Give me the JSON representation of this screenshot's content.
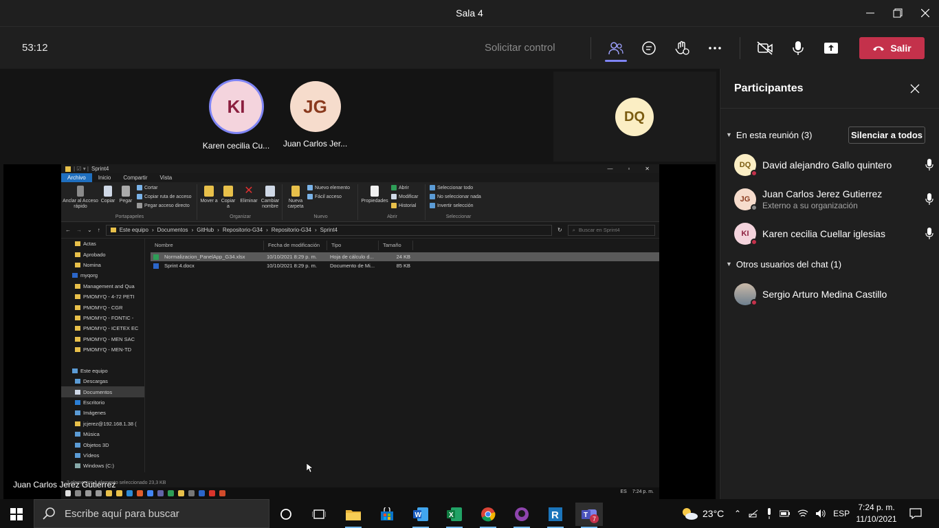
{
  "window": {
    "title": "Sala 4"
  },
  "meeting": {
    "timer": "53:12",
    "request_control": "Solicitar control",
    "leave_label": "Salir",
    "colors": {
      "accent": "#7f85f5",
      "leave": "#c4314b"
    }
  },
  "stage": {
    "tiles": [
      {
        "initials": "KI",
        "name": "Karen cecilia Cu..."
      },
      {
        "initials": "JG",
        "name": "Juan Carlos Jer..."
      }
    ],
    "side_tile": {
      "initials": "DQ"
    },
    "share_presenter": "Juan Carlos Jerez Gutierrez"
  },
  "explorer": {
    "title": "Sprint4",
    "menu": [
      "Archivo",
      "Inicio",
      "Compartir",
      "Vista"
    ],
    "ribbon": {
      "clipboard": {
        "pin": "Anclar al Acceso rápido",
        "copy": "Copiar",
        "paste": "Pegar",
        "cut": "Cortar",
        "copy_path": "Copiar ruta de acceso",
        "paste_shortcut": "Pegar acceso directo",
        "group": "Portapapeles"
      },
      "organize": {
        "move": "Mover a",
        "copy_to": "Copiar a",
        "delete": "Eliminar",
        "rename": "Cambiar nombre",
        "group": "Organizar"
      },
      "new": {
        "folder": "Nueva carpeta",
        "new_item": "Nuevo elemento",
        "easy_access": "Fácil acceso",
        "group": "Nuevo"
      },
      "open": {
        "properties": "Propiedades",
        "open": "Abrir",
        "edit": "Modificar",
        "history": "Historial",
        "group": "Abrir"
      },
      "select": {
        "all": "Seleccionar todo",
        "none": "No seleccionar nada",
        "invert": "Invertir selección",
        "group": "Seleccionar"
      }
    },
    "breadcrumb": [
      "Este equipo",
      "Documentos",
      "GitHub",
      "Repositorio-G34",
      "Repositorio-G34",
      "Sprint4"
    ],
    "search_placeholder": "Buscar en Sprint4",
    "tree": [
      "Actas",
      "Aprobado",
      "Nomina",
      "myqorg",
      "Management and Qua",
      "PMOMYQ - 4-72 PETI",
      "PMOMYQ - CGR",
      "PMOMYQ - FONTIC -",
      "PMOMYQ - ICETEX EC",
      "PMOMYQ - MEN SAC",
      "PMOMYQ - MEN-TD",
      "",
      "Este equipo",
      "Descargas",
      "Documentos",
      "Escritorio",
      "Imágenes",
      "jcjerez@192.168.1.38 (",
      "Música",
      "Objetos 3D",
      "Vídeos",
      "Windows (C:)"
    ],
    "columns": [
      "Nombre",
      "Fecha de modificación",
      "Tipo",
      "Tamaño"
    ],
    "files": [
      {
        "name": "Normalizacion_PanelApp_G34.xlsx",
        "date": "10/10/2021 8:29 p. m.",
        "type": "Hoja de cálculo d...",
        "size": "24 KB"
      },
      {
        "name": "Sprint 4.docx",
        "date": "10/10/2021 8:29 p. m.",
        "type": "Documento de Mi...",
        "size": "85 KB"
      }
    ],
    "status": "2 elementos   1 elemento seleccionado  23,3 KB",
    "taskbar": {
      "lang": "ES",
      "time": "7:24 p. m."
    }
  },
  "panel": {
    "title": "Participantes",
    "in_meeting": "En esta reunión (3)",
    "mute_all": "Silenciar a todos",
    "participants": [
      {
        "initials": "DQ",
        "name": "David alejandro Gallo quintero",
        "sub": ""
      },
      {
        "initials": "JG",
        "name": "Juan Carlos Jerez Gutierrez",
        "sub": "Externo a su organización"
      },
      {
        "initials": "KI",
        "name": "Karen cecilia Cuellar iglesias",
        "sub": ""
      }
    ],
    "others": "Otros usuarios del chat (1)",
    "chat_users": [
      {
        "name": "Sergio Arturo Medina Castillo"
      }
    ]
  },
  "taskbar": {
    "search_placeholder": "Escribe aquí para buscar",
    "weather": "23°C",
    "lang": "ESP",
    "time": "7:24 p. m.",
    "date": "11/10/2021",
    "teams_badge": "7"
  }
}
